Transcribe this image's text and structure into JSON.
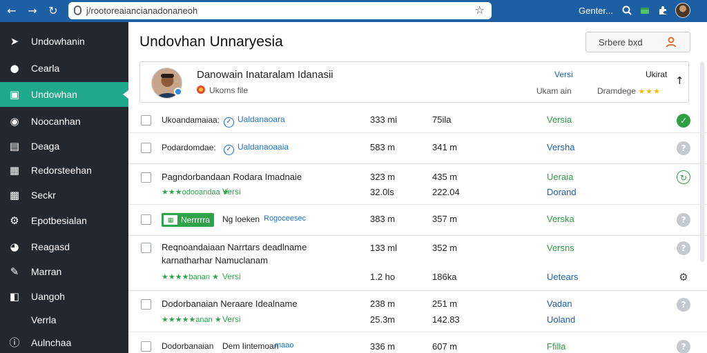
{
  "browser": {
    "url": "j/rootoreaiancianadonaneoh",
    "user_label": "Genter..."
  },
  "sidebar": {
    "items": [
      {
        "label": "Undowhanin",
        "icon": "pin-icon"
      },
      {
        "label": "Cearla",
        "icon": "user-icon"
      },
      {
        "label": "Undowhan",
        "icon": "layout-icon",
        "active": true
      },
      {
        "label": "Noocanhan",
        "icon": "bell-icon"
      },
      {
        "label": "Deaga",
        "icon": "list-icon"
      },
      {
        "label": "Redorsteehan",
        "icon": "grid-icon"
      },
      {
        "label": "Seckr",
        "icon": "shield-icon"
      },
      {
        "label": "Epotbesialan",
        "icon": "gear-icon"
      },
      {
        "label": "Reagasd",
        "icon": "globe-icon"
      },
      {
        "label": "Marran",
        "icon": "pen-icon"
      },
      {
        "label": "Uangoh",
        "icon": "page-icon"
      },
      {
        "label": "Verrla",
        "icon": ""
      },
      {
        "label": "Aulnchaa",
        "icon": "info-icon"
      }
    ]
  },
  "main": {
    "title": "Undovhan Unnaryesia",
    "header_button": "Srbere bxd",
    "profile": {
      "name": "Danowain Inataralam Idanasii",
      "subtitle": "Ukoms file",
      "col1_top": "Versi",
      "col1_bottom": "Ukam ain",
      "col2_top": "Ukirat",
      "col2_bottom": "Dramdege",
      "stars": "★★★"
    },
    "rows": [
      {
        "line1": "Ukoandamaiaa:",
        "tag": "Ualdanaoara",
        "v1": "333 mi",
        "v2": "75ila",
        "status": "Versia",
        "status_color": "green",
        "action": "ok"
      },
      {
        "line1": "Podardomdae:",
        "tag": "Ualdanaoaaia",
        "v1": "583 m",
        "v2": "341 m",
        "status": "Versha",
        "status_color": "blue",
        "action": "help"
      },
      {
        "line1": "Pagndorbandaan Rodara Imadnaie",
        "sub_dim": "★★★odooandaa ★",
        "sub_green": "Versi",
        "v1": "323 m",
        "v2": "435 m",
        "v1b": "32.0ls",
        "v2b": "222.04",
        "status": "Ueraia",
        "status2": "Dorand",
        "status_color": "green",
        "action": "outline"
      },
      {
        "line1": "Ng loeken",
        "tag_plain": "Rogoceesec",
        "badge": "Nerrrrra",
        "v1": "383 m",
        "v2": "357 m",
        "status": "Verska",
        "status_color": "green",
        "action": "help"
      },
      {
        "line1": "Reqnoandaiaan Narrtars deadlname",
        "line2": "karnatharhar Namuclanam",
        "sub_dim": "★★★★banan ★",
        "sub_green": "Versi",
        "v1": "133 ml",
        "v2": "352 m",
        "v1b": "1.2 ho",
        "v2b": "186ka",
        "status": "Versns",
        "status2": "Uetears",
        "status_color": "green",
        "action": "help"
      },
      {
        "line1": "Dodorbanaian Neraare Idealname",
        "sub_dim": "★★★★★anan ★",
        "sub_green": "Versi",
        "v1": "238 m",
        "v2": "251 m",
        "v1b": "25.3m",
        "v2b": "142.83",
        "status": "Vadan",
        "status2": "Uoland",
        "status_color": "green",
        "action": "help"
      },
      {
        "line1": "Dodorbanaian",
        "line_extra": "Dem Iintemoan",
        "tag_plain": "maao",
        "v1": "336 m",
        "v2": "607 m",
        "status": "Ffilla",
        "status_color": "green",
        "action": "help"
      }
    ]
  },
  "colors": {
    "topbar": "#1d5fa3",
    "sidebar": "#23272e",
    "accent": "#1fa88a",
    "status_green": "#2f9e44",
    "status_blue": "#1f5fb0"
  }
}
